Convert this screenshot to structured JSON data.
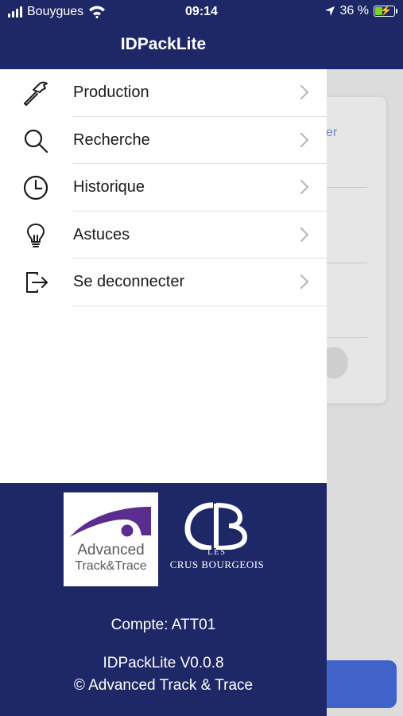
{
  "status_bar": {
    "carrier": "Bouygues",
    "time": "09:14",
    "battery": "36 %",
    "battery_level": 0.36
  },
  "header": {
    "title": "IDPackLite"
  },
  "menu": {
    "items": [
      {
        "label": "Production",
        "icon": "hammer-icon"
      },
      {
        "label": "Recherche",
        "icon": "search-icon"
      },
      {
        "label": "Historique",
        "icon": "clock-icon"
      },
      {
        "label": "Astuces",
        "icon": "lightbulb-icon"
      },
      {
        "label": "Se deconnecter",
        "icon": "logout-icon"
      }
    ]
  },
  "background": {
    "card_fragment": "er"
  },
  "footer": {
    "logo_att_line1": "Advanced",
    "logo_att_line2": "Track&Trace",
    "logo_cb_les": "LES",
    "logo_cb_name": "CRUS BOURGEOIS",
    "account": "Compte: ATT01",
    "version": "IDPackLite V0.0.8",
    "copyright": "© Advanced Track & Trace"
  },
  "colors": {
    "brand_navy": "#1f2866",
    "accent_blue": "#3f63c9",
    "logo_purple": "#5b2d8e"
  }
}
